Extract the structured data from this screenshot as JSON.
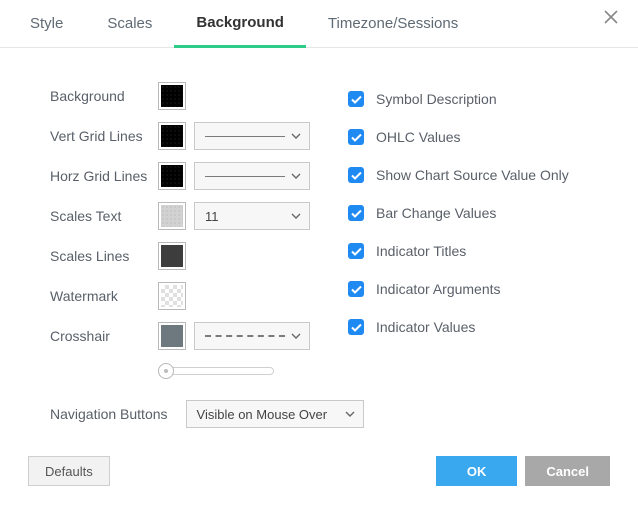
{
  "tabs": {
    "style": "Style",
    "scales": "Scales",
    "background": "Background",
    "timezone": "Timezone/Sessions"
  },
  "left": {
    "background": "Background",
    "vert_grid": "Vert Grid Lines",
    "horz_grid": "Horz Grid Lines",
    "scales_text": "Scales Text",
    "scales_lines": "Scales Lines",
    "watermark": "Watermark",
    "crosshair": "Crosshair",
    "font_size": "11",
    "nav_label": "Navigation Buttons",
    "nav_value": "Visible on Mouse Over"
  },
  "right": {
    "symbol_desc": "Symbol Description",
    "ohlc": "OHLC Values",
    "source_only": "Show Chart Source Value Only",
    "bar_change": "Bar Change Values",
    "ind_titles": "Indicator Titles",
    "ind_args": "Indicator Arguments",
    "ind_values": "Indicator Values"
  },
  "footer": {
    "defaults": "Defaults",
    "ok": "OK",
    "cancel": "Cancel"
  }
}
